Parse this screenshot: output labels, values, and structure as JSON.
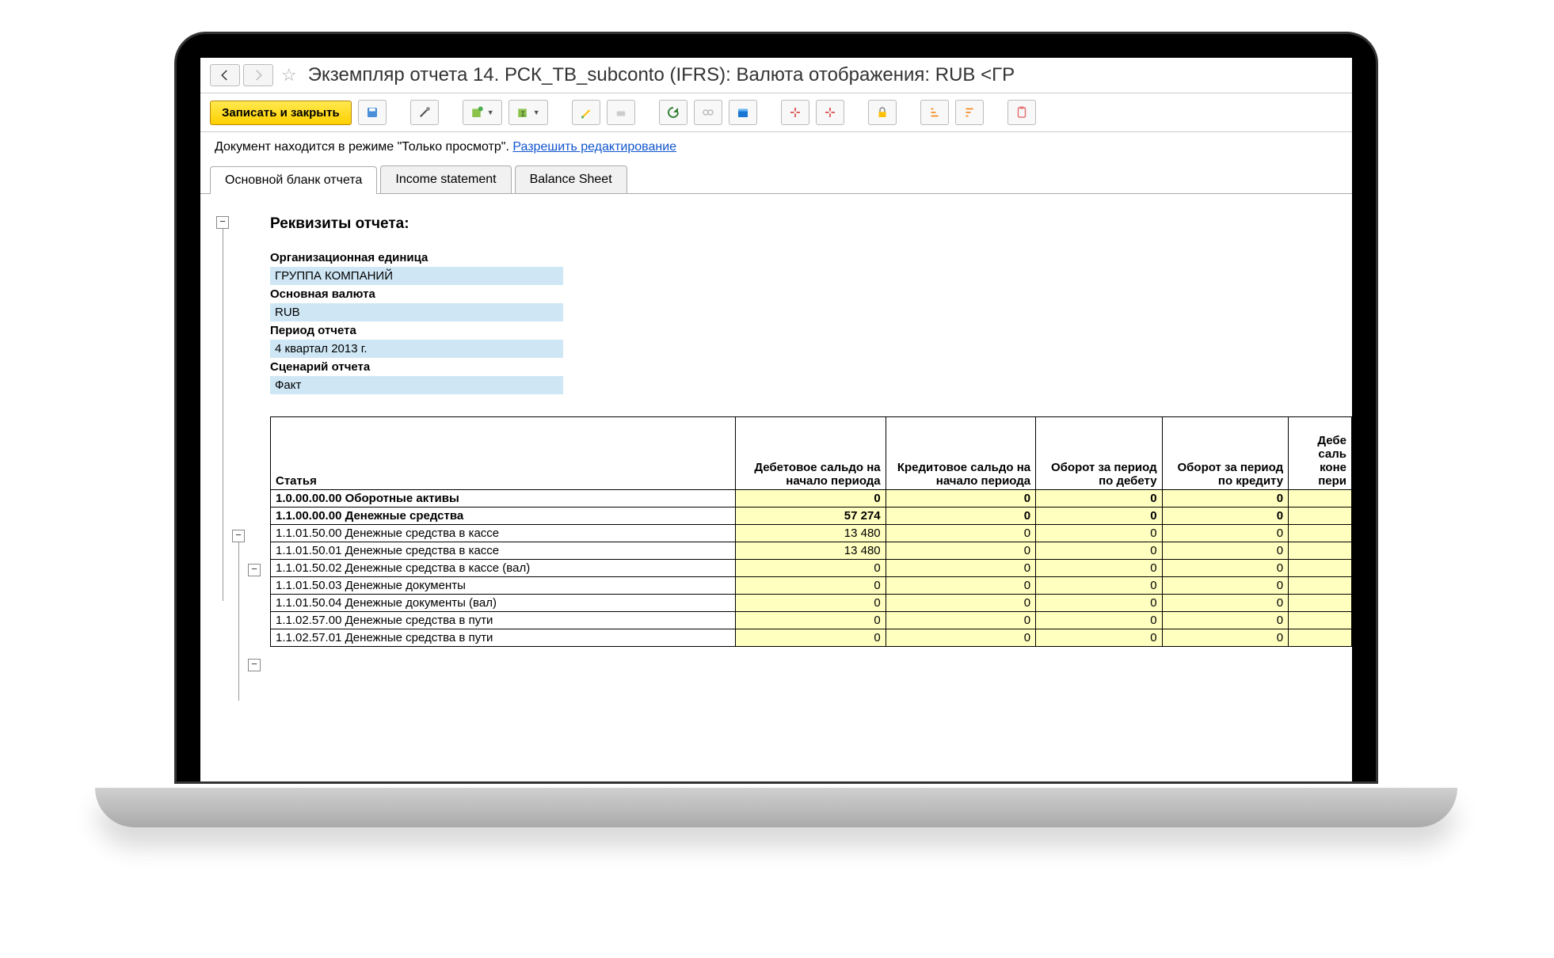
{
  "header": {
    "title": "Экземпляр отчета 14. РСК_ТВ_subconto (IFRS):  Валюта отображения:  RUB <ГР"
  },
  "toolbar": {
    "save_close_label": "Записать и закрыть"
  },
  "status": {
    "text": "Документ находится в режиме \"Только просмотр\".  ",
    "link": "Разрешить редактирование"
  },
  "tabs": [
    {
      "label": "Основной бланк отчета",
      "active": true
    },
    {
      "label": "Income statement",
      "active": false
    },
    {
      "label": "Balance Sheet",
      "active": false
    }
  ],
  "report": {
    "heading": "Реквизиты отчета:",
    "attrs": [
      {
        "label": "Организационная единица",
        "value": "ГРУППА КОМПАНИЙ"
      },
      {
        "label": "Основная валюта",
        "value": "RUB"
      },
      {
        "label": "Период отчета",
        "value": "4 квартал 2013 г."
      },
      {
        "label": "Сценарий отчета",
        "value": "Факт"
      }
    ]
  },
  "table": {
    "headers": [
      "Статья",
      "Дебетовое сальдо на начало периода",
      "Кредитовое сальдо на начало периода",
      "Оборот за период по дебету",
      "Оборот за период по кредиту",
      "Дебе саль коне пери"
    ],
    "rows": [
      {
        "article": "1.0.00.00.00 Оборотные активы",
        "bold": true,
        "c": [
          "0",
          "0",
          "0",
          "0",
          ""
        ]
      },
      {
        "article": "1.1.00.00.00 Денежные средства",
        "bold": true,
        "c": [
          "57 274",
          "0",
          "0",
          "0",
          ""
        ]
      },
      {
        "article": "1.1.01.50.00 Денежные средства в кассе",
        "bold": false,
        "c": [
          "13 480",
          "0",
          "0",
          "0",
          ""
        ]
      },
      {
        "article": "1.1.01.50.01 Денежные средства в кассе",
        "bold": false,
        "c": [
          "13 480",
          "0",
          "0",
          "0",
          ""
        ]
      },
      {
        "article": "1.1.01.50.02 Денежные средства в кассе (вал)",
        "bold": false,
        "c": [
          "0",
          "0",
          "0",
          "0",
          ""
        ]
      },
      {
        "article": "1.1.01.50.03 Денежные документы",
        "bold": false,
        "c": [
          "0",
          "0",
          "0",
          "0",
          ""
        ]
      },
      {
        "article": "1.1.01.50.04 Денежные документы (вал)",
        "bold": false,
        "c": [
          "0",
          "0",
          "0",
          "0",
          ""
        ]
      },
      {
        "article": "1.1.02.57.00 Денежные средства в пути",
        "bold": false,
        "c": [
          "0",
          "0",
          "0",
          "0",
          ""
        ]
      },
      {
        "article": "1.1.02.57.01 Денежные средства в пути",
        "bold": false,
        "c": [
          "0",
          "0",
          "0",
          "0",
          ""
        ]
      }
    ]
  }
}
